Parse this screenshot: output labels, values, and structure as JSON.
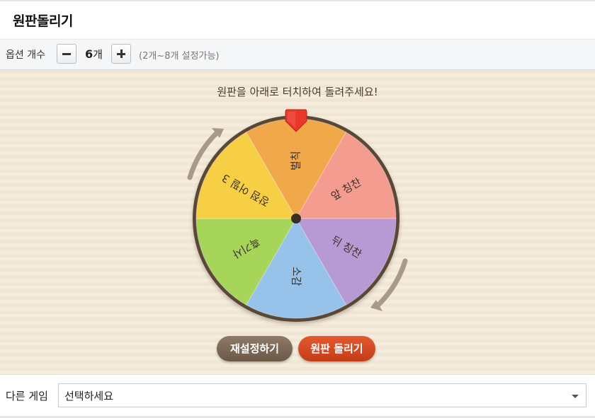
{
  "header": {
    "title": "원판돌리기"
  },
  "options": {
    "label": "옵션 개수",
    "count_number": "6",
    "count_unit": "개",
    "hint": "(2개~8개 설정가능)"
  },
  "wheel": {
    "instruction": "원판을 아래로 터치하여 돌려주세요!",
    "segments": [
      {
        "label": "벌칙",
        "color": "#f0a84b"
      },
      {
        "label": "앞 칭찬",
        "color": "#f59c91"
      },
      {
        "label": "뒤 칭찬",
        "color": "#b79ad4"
      },
      {
        "label": "소감",
        "color": "#97c2ea"
      },
      {
        "label": "흑기사",
        "color": "#a6d55a"
      },
      {
        "label": "장점 어필 3",
        "color": "#f7cf45"
      }
    ]
  },
  "buttons": {
    "reset": "재설정하기",
    "spin": "원판 돌리기"
  },
  "footer": {
    "label": "다른 게임",
    "select_value": "선택하세요"
  },
  "colors": {
    "reset_button": "#7a6654",
    "spin_button": "#d84a22",
    "pointer": "#e8382a",
    "wheel_rim": "#5a4636"
  }
}
